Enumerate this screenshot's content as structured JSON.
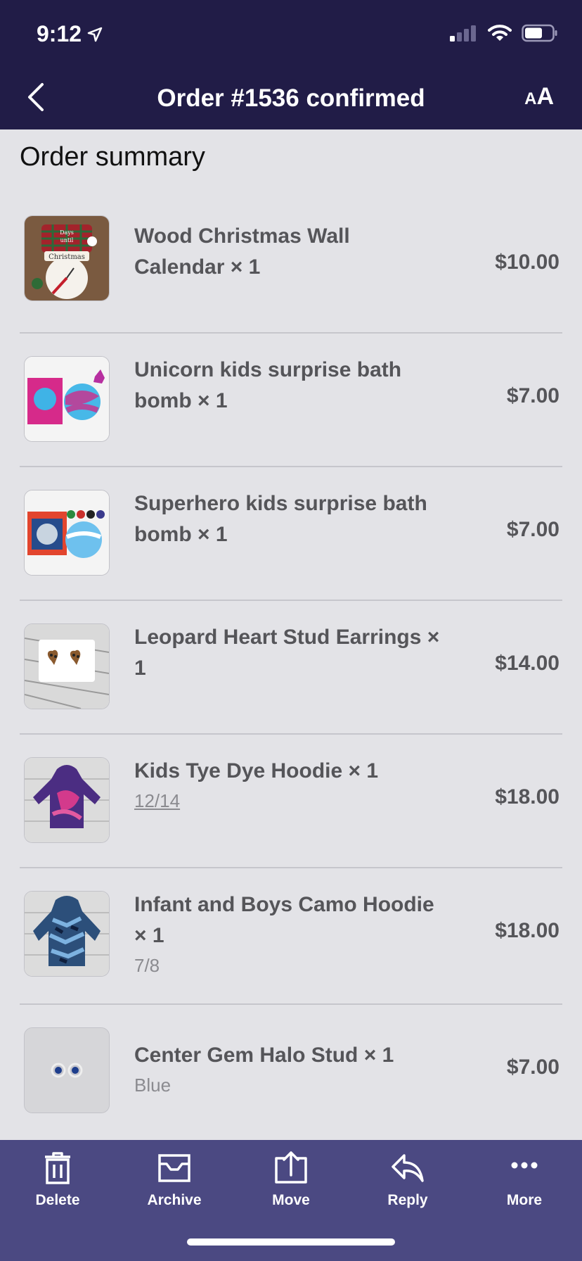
{
  "status": {
    "time": "9:12"
  },
  "nav": {
    "title": "Order #1536 confirmed",
    "text_size_big": "A",
    "text_size_small": "A"
  },
  "summary": {
    "title": "Order summary"
  },
  "items": [
    {
      "name": "Wood Christmas Wall Calendar × 1",
      "variant": "",
      "price": "$10.00",
      "thumb_words": [
        "Days",
        "until",
        "Christmas"
      ]
    },
    {
      "name": "Unicorn kids surprise bath bomb × 1",
      "variant": "",
      "price": "$7.00"
    },
    {
      "name": "Superhero kids surprise bath bomb × 1",
      "variant": "",
      "price": "$7.00"
    },
    {
      "name": "Leopard Heart Stud Earrings × 1",
      "variant": "",
      "price": "$14.00"
    },
    {
      "name": "Kids Tye Dye Hoodie × 1",
      "variant": "12/14",
      "price": "$18.00"
    },
    {
      "name": "Infant and Boys Camo Hoodie × 1",
      "variant": "7/8",
      "price": "$18.00"
    },
    {
      "name": "Center Gem Halo Stud × 1",
      "variant": "Blue",
      "price": "$7.00"
    }
  ],
  "toolbar": {
    "delete": "Delete",
    "archive": "Archive",
    "move": "Move",
    "reply": "Reply",
    "more": "More"
  },
  "colors": {
    "header_bg": "#211c47",
    "toolbar_bg": "#4b4982",
    "content_bg": "#e3e3e7"
  }
}
